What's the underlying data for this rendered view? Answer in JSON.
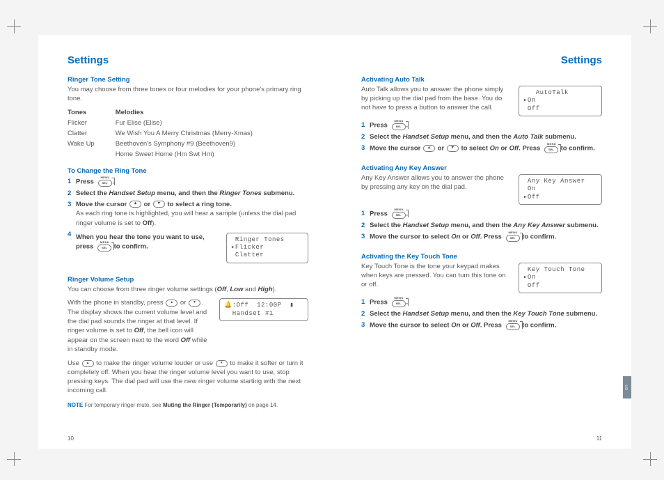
{
  "left": {
    "title": "Settings",
    "sec1": {
      "heading": "Ringer Tone Setting",
      "intro": "You may choose from three tones or four melodies for your phone's primary ring tone.",
      "tones_header": "Tones",
      "melodies_header": "Melodies",
      "rows": [
        {
          "tone": "Flicker",
          "melody": "Fur Elise (Elise)"
        },
        {
          "tone": "Clatter",
          "melody": "We Wish You A Merry Christmas (Merry-Xmas)"
        },
        {
          "tone": "Wake Up",
          "melody": "Beethoven's Symphony #9 (Beethoven9)"
        },
        {
          "tone": "",
          "melody": "Home Sweet Home (Hm Swt Hm)"
        }
      ]
    },
    "sec2": {
      "heading": "To Change the Ring Tone",
      "step1a": "Press ",
      "step1b": ".",
      "step2a": "Select the ",
      "step2b": "Handset Setup",
      "step2c": " menu, and then the ",
      "step2d": "Ringer Tones",
      "step2e": " submenu.",
      "step3a": "Move the cursor ",
      "step3b": " or ",
      "step3c": " to select a ring tone.",
      "step3note1": "As each ring tone is highlighted, you will hear a sample (unless the dial pad ringer volume is set to ",
      "step3note2": "Off",
      "step3note3": ").",
      "step4a": "When you hear the tone you want to use, press ",
      "step4b": " to confirm.",
      "lcd": " Ringer Tones\n▸Flicker\n Clatter"
    },
    "sec3": {
      "heading": "Ringer Volume Setup",
      "intro1": "You can choose from three ringer volume settings (",
      "intro_off": "Off",
      "intro_comma": ", ",
      "intro_low": "Low",
      "intro_and": " and ",
      "intro_high": "High",
      "intro_end": ").",
      "p2a": "With the phone in standby, press ",
      "p2b": " or ",
      "p2c": ". The display shows the current volume level and the dial pad sounds the ringer at that level. If ringer volume is set to ",
      "p2off": "Off",
      "p2d": ", the bell icon will appear on the screen next to the word ",
      "p2off2": "Off",
      "p2e": " while in standby mode.",
      "lcd": "🔔:Off  12:00P  ▮\n  Handset #1",
      "p3a": "Use ",
      "p3b": " to make the ringer volume louder or use ",
      "p3c": " to make it softer or turn it completely off. When you hear the ringer volume level you want to use, stop pressing keys. The dial pad will use the new ringer volume starting with the next incoming call.",
      "note_label": "NOTE",
      "note_a": "  For temporary ringer mute, see ",
      "note_b": "Muting the Ringer (Temporarily)",
      "note_c": " on page 14."
    },
    "pagenum": "10"
  },
  "right": {
    "title": "Settings",
    "sec1": {
      "heading": "Activating Auto Talk",
      "intro": "Auto Talk allows you to answer the phone simply by picking up the dial pad from the base. You do not have to press a button to answer the call.",
      "lcd": "   AutoTalk\n▸On\n Off",
      "step1a": "Press ",
      "step1b": ".",
      "step2a": "Select the ",
      "step2b": "Handset Setup",
      "step2c": " menu, and then the ",
      "step2d": "Auto Talk",
      "step2e": " submenu.",
      "step3a": "Move the cursor ",
      "step3b": " or ",
      "step3c": " to select ",
      "step3on": "On",
      "step3or": " or ",
      "step3off": "Off",
      "step3d": ". Press ",
      "step3e": " to confirm."
    },
    "sec2": {
      "heading": "Activating Any Key Answer",
      "intro": "Any Key Answer allows you to answer the phone by pressing any key on the dial pad.",
      "lcd": " Any Key Answer\n On\n▸Off",
      "step1a": "Press ",
      "step1b": ".",
      "step2a": "Select the ",
      "step2b": "Handset Setup",
      "step2c": " menu, and then the ",
      "step2d": "Any Key Answer",
      "step2e": " submenu.",
      "step3a": "Move the cursor to select ",
      "step3on": "On",
      "step3or": " or ",
      "step3off": "Off",
      "step3b": ". Press ",
      "step3c": " to confirm."
    },
    "sec3": {
      "heading": "Activating the Key Touch Tone",
      "intro": "Key Touch Tone is the tone your keypad makes when keys are pressed. You can turn this tone on or off.",
      "lcd": " Key Touch Tone\n▸On\n Off",
      "step1a": "Press ",
      "step1b": ".",
      "step2a": "Select the ",
      "step2b": "Handset Setup",
      "step2c": " menu, and then the ",
      "step2d": "Key Touch Tone",
      "step2e": " submenu.",
      "step3a": "Move the cursor to select ",
      "step3on": "On",
      "step3or": " or ",
      "step3off": "Off",
      "step3b": ". Press ",
      "step3c": " to confirm."
    },
    "tab": "en",
    "pagenum": "11"
  }
}
